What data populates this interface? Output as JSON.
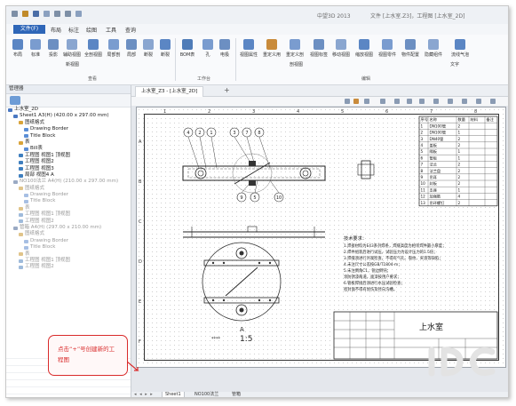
{
  "app": {
    "name": "中望3D 2013",
    "document_title": "文件 [上水室.Z3]，工程图 [上水室_2D]"
  },
  "menu": {
    "file": "文件(F)",
    "items": [
      "布局",
      "标注",
      "绘图",
      "工具",
      "查询"
    ]
  },
  "ribbon": {
    "buttons": [
      "布局",
      "标准",
      "投影",
      "辅助视图",
      "全剖视图",
      "局部剖",
      "局部",
      "断裂",
      "断裂",
      "BOM表",
      "孔",
      "电极",
      "视图属性",
      "重定义用",
      "重定义剖",
      "视图标签",
      "移动视图",
      "缩放视图",
      "视图零件",
      "物件配置",
      "隐藏组件",
      "流线气泡"
    ],
    "small_labels": [
      "新视图",
      "剖视图",
      "文字"
    ],
    "groups": [
      "查看",
      "工作台",
      "编辑"
    ]
  },
  "left_panel": {
    "title": "管理器",
    "tree": [
      {
        "label": "上水室_2D",
        "level": 0,
        "dim": false,
        "color": "#4a78c2"
      },
      {
        "label": "Sheet1 A3(H) (420.00 x 297.00 mm)",
        "level": 1,
        "dim": false,
        "color": "#4a78c2"
      },
      {
        "label": "图纸格式",
        "level": 2,
        "dim": false,
        "color": "#d9a43a"
      },
      {
        "label": "Drawing Border",
        "level": 3,
        "dim": false,
        "color": "#5a8ed6"
      },
      {
        "label": "Title Block",
        "level": 3,
        "dim": false,
        "color": "#5a8ed6"
      },
      {
        "label": "表",
        "level": 2,
        "dim": false,
        "color": "#d9a43a"
      },
      {
        "label": "Bill表",
        "level": 3,
        "dim": false,
        "color": "#5a8ed6"
      },
      {
        "label": "工程图 视图1 顶视图",
        "level": 2,
        "dim": false,
        "color": "#3f7fbf"
      },
      {
        "label": "工程图 视图2",
        "level": 2,
        "dim": false,
        "color": "#3f7fbf"
      },
      {
        "label": "工程图 视图3",
        "level": 2,
        "dim": false,
        "color": "#3f7fbf"
      },
      {
        "label": "局部 视图4 A",
        "level": 2,
        "dim": false,
        "color": "#3f7fbf"
      },
      {
        "label": "NO100法兰 A4(H) (210.00 x 297.00 mm)",
        "level": 1,
        "dim": true,
        "color": "#9aaac4"
      },
      {
        "label": "图纸格式",
        "level": 2,
        "dim": true,
        "color": "#e0c48a"
      },
      {
        "label": "Drawing Border",
        "level": 3,
        "dim": true,
        "color": "#a7bfe3"
      },
      {
        "label": "Title Block",
        "level": 3,
        "dim": true,
        "color": "#a7bfe3"
      },
      {
        "label": "表",
        "level": 2,
        "dim": true,
        "color": "#e0c48a"
      },
      {
        "label": "工程图 视图1 顶视图",
        "level": 2,
        "dim": true,
        "color": "#9fbbdb"
      },
      {
        "label": "工程图 视图2",
        "level": 2,
        "dim": true,
        "color": "#9fbbdb"
      },
      {
        "label": "管箱 A4(H) (297.00 x 210.00 mm)",
        "level": 1,
        "dim": true,
        "color": "#9aaac4"
      },
      {
        "label": "图纸格式",
        "level": 2,
        "dim": true,
        "color": "#e0c48a"
      },
      {
        "label": "Drawing Border",
        "level": 3,
        "dim": true,
        "color": "#a7bfe3"
      },
      {
        "label": "Title Block",
        "level": 3,
        "dim": true,
        "color": "#a7bfe3"
      },
      {
        "label": "表",
        "level": 2,
        "dim": true,
        "color": "#e0c48a"
      },
      {
        "label": "工程图 视图1 顶视图",
        "level": 2,
        "dim": true,
        "color": "#9fbbdb"
      },
      {
        "label": "工程图 视图2",
        "level": 2,
        "dim": true,
        "color": "#9fbbdb"
      }
    ]
  },
  "document": {
    "tab": "上水室_Z3 - [上水室_2D]",
    "add_tab": "+",
    "drawing_title": "上水室",
    "view_label": "A",
    "scale": "1:5",
    "scale_prefix": "****",
    "balloons": [
      "4",
      "2",
      "1",
      "3",
      "7",
      "8",
      "9",
      "5",
      "10"
    ],
    "notes_title": "技术要求：",
    "notes": [
      "1.焊接材料为E43系列焊条，焊缝高度为相邻焊件最小厚度；",
      "2.焊件组装后进行试压，试验压力为设计压力的1.5倍；",
      "3.焊缝须进行外观检查，不得有气孔、裂纹、夹渣等缺陷；",
      "4.未注尺寸公差按GB/T1804-m；",
      "5.未注倒角C1，锐边倒钝；",
      "  涂防锈漆两道，面漆按用户要求；",
      "6.管板焊接后须进行水压试验检查；",
      "  密封面不得有划伤及径向沟槽。"
    ],
    "bom_headers": [
      "序号",
      "名称",
      "数量",
      "材料",
      "备注"
    ],
    "bom_rows": [
      [
        "1",
        "DN100管",
        "2",
        "",
        ""
      ],
      [
        "2",
        "DN100管",
        "1",
        "",
        ""
      ],
      [
        "3",
        "DN40管",
        "2",
        "",
        ""
      ],
      [
        "4",
        "盖板",
        "2",
        "",
        ""
      ],
      [
        "5",
        "隔板",
        "1",
        "",
        ""
      ],
      [
        "6",
        "管板",
        "1",
        "",
        ""
      ],
      [
        "7",
        "法兰",
        "2",
        "",
        ""
      ],
      [
        "8",
        "法兰盘",
        "2",
        "",
        ""
      ],
      [
        "9",
        "吊耳",
        "2",
        "",
        ""
      ],
      [
        "10",
        "封板",
        "2",
        "",
        ""
      ],
      [
        "11",
        "支座",
        "1",
        "",
        ""
      ],
      [
        "12",
        "加强筋",
        "4",
        "",
        ""
      ],
      [
        "13",
        "吊环螺钉",
        "2",
        "",
        ""
      ]
    ],
    "ruler_numbers": [
      "1",
      "2",
      "3",
      "4",
      "5",
      "6",
      "7",
      "8",
      "A",
      "B",
      "C",
      "D",
      "E",
      "F"
    ]
  },
  "callout": {
    "text": "点击“+”号创建新的工程图",
    "color": "#d92b2b"
  },
  "sheet_tabs": {
    "nav": "◂ ◂ ▸ ▸",
    "tabs": [
      "Sheet1",
      "NO100法兰",
      "管箱"
    ],
    "active_index": 0
  },
  "colors": {
    "accent": "#2e66b8",
    "callout": "#d92b2b"
  }
}
